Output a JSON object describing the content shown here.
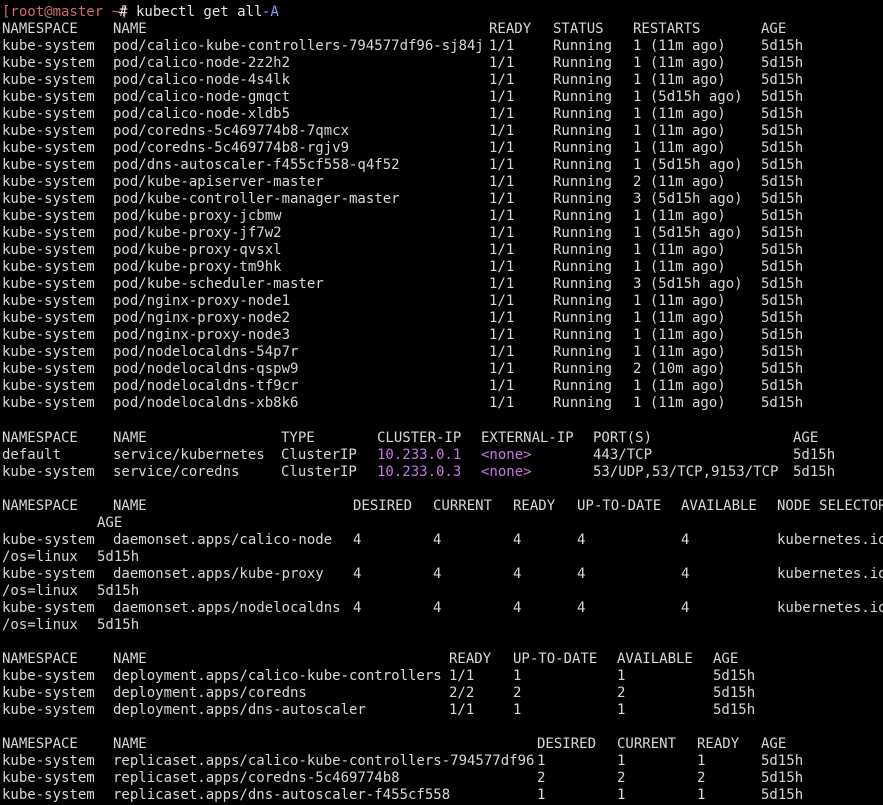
{
  "prompt": {
    "user_host": "[root@master ~]",
    "symbol": "# ",
    "command": "kubectl get all ",
    "flag": "-A"
  },
  "pods": {
    "headers": [
      "NAMESPACE",
      "NAME",
      "READY",
      "STATUS",
      "RESTARTS",
      "AGE"
    ],
    "rows": [
      [
        "kube-system",
        "pod/calico-kube-controllers-794577df96-sj84j",
        "1/1",
        "Running",
        "1 (11m ago)",
        "5d15h"
      ],
      [
        "kube-system",
        "pod/calico-node-2z2h2",
        "1/1",
        "Running",
        "1 (11m ago)",
        "5d15h"
      ],
      [
        "kube-system",
        "pod/calico-node-4s4lk",
        "1/1",
        "Running",
        "1 (11m ago)",
        "5d15h"
      ],
      [
        "kube-system",
        "pod/calico-node-gmqct",
        "1/1",
        "Running",
        "1 (5d15h ago)",
        "5d15h"
      ],
      [
        "kube-system",
        "pod/calico-node-xldb5",
        "1/1",
        "Running",
        "1 (11m ago)",
        "5d15h"
      ],
      [
        "kube-system",
        "pod/coredns-5c469774b8-7qmcx",
        "1/1",
        "Running",
        "1 (11m ago)",
        "5d15h"
      ],
      [
        "kube-system",
        "pod/coredns-5c469774b8-rgjv9",
        "1/1",
        "Running",
        "1 (11m ago)",
        "5d15h"
      ],
      [
        "kube-system",
        "pod/dns-autoscaler-f455cf558-q4f52",
        "1/1",
        "Running",
        "1 (5d15h ago)",
        "5d15h"
      ],
      [
        "kube-system",
        "pod/kube-apiserver-master",
        "1/1",
        "Running",
        "2 (11m ago)",
        "5d15h"
      ],
      [
        "kube-system",
        "pod/kube-controller-manager-master",
        "1/1",
        "Running",
        "3 (5d15h ago)",
        "5d15h"
      ],
      [
        "kube-system",
        "pod/kube-proxy-jcbmw",
        "1/1",
        "Running",
        "1 (11m ago)",
        "5d15h"
      ],
      [
        "kube-system",
        "pod/kube-proxy-jf7w2",
        "1/1",
        "Running",
        "1 (5d15h ago)",
        "5d15h"
      ],
      [
        "kube-system",
        "pod/kube-proxy-qvsxl",
        "1/1",
        "Running",
        "1 (11m ago)",
        "5d15h"
      ],
      [
        "kube-system",
        "pod/kube-proxy-tm9hk",
        "1/1",
        "Running",
        "1 (11m ago)",
        "5d15h"
      ],
      [
        "kube-system",
        "pod/kube-scheduler-master",
        "1/1",
        "Running",
        "3 (5d15h ago)",
        "5d15h"
      ],
      [
        "kube-system",
        "pod/nginx-proxy-node1",
        "1/1",
        "Running",
        "1 (11m ago)",
        "5d15h"
      ],
      [
        "kube-system",
        "pod/nginx-proxy-node2",
        "1/1",
        "Running",
        "1 (11m ago)",
        "5d15h"
      ],
      [
        "kube-system",
        "pod/nginx-proxy-node3",
        "1/1",
        "Running",
        "1 (11m ago)",
        "5d15h"
      ],
      [
        "kube-system",
        "pod/nodelocaldns-54p7r",
        "1/1",
        "Running",
        "1 (11m ago)",
        "5d15h"
      ],
      [
        "kube-system",
        "pod/nodelocaldns-qspw9",
        "1/1",
        "Running",
        "2 (10m ago)",
        "5d15h"
      ],
      [
        "kube-system",
        "pod/nodelocaldns-tf9cr",
        "1/1",
        "Running",
        "1 (11m ago)",
        "5d15h"
      ],
      [
        "kube-system",
        "pod/nodelocaldns-xb8k6",
        "1/1",
        "Running",
        "1 (11m ago)",
        "5d15h"
      ]
    ]
  },
  "services": {
    "headers": [
      "NAMESPACE",
      "NAME",
      "TYPE",
      "CLUSTER-IP",
      "EXTERNAL-IP",
      "PORT(S)",
      "AGE"
    ],
    "rows": [
      [
        "default",
        "service/kubernetes",
        "ClusterIP",
        "10.233.0.1",
        "<none>",
        "443/TCP",
        "5d15h"
      ],
      [
        "kube-system",
        "service/coredns",
        "ClusterIP",
        "10.233.0.3",
        "<none>",
        "53/UDP,53/TCP,9153/TCP",
        "5d15h"
      ]
    ]
  },
  "daemonsets": {
    "headers": [
      "NAMESPACE",
      "NAME",
      "DESIRED",
      "CURRENT",
      "READY",
      "UP-TO-DATE",
      "AVAILABLE",
      "NODE SELECTOR"
    ],
    "header_wrap": "AGE",
    "rows": [
      {
        "cells": [
          "kube-system",
          "daemonset.apps/calico-node",
          "4",
          "4",
          "4",
          "4",
          "4",
          "kubernetes.io"
        ],
        "wrap": [
          "/os=linux",
          "5d15h"
        ]
      },
      {
        "cells": [
          "kube-system",
          "daemonset.apps/kube-proxy",
          "4",
          "4",
          "4",
          "4",
          "4",
          "kubernetes.io"
        ],
        "wrap": [
          "/os=linux",
          "5d15h"
        ]
      },
      {
        "cells": [
          "kube-system",
          "daemonset.apps/nodelocaldns",
          "4",
          "4",
          "4",
          "4",
          "4",
          "kubernetes.io"
        ],
        "wrap": [
          "/os=linux",
          "5d15h"
        ]
      }
    ]
  },
  "deployments": {
    "headers": [
      "NAMESPACE",
      "NAME",
      "READY",
      "UP-TO-DATE",
      "AVAILABLE",
      "AGE"
    ],
    "rows": [
      [
        "kube-system",
        "deployment.apps/calico-kube-controllers",
        "1/1",
        "1",
        "1",
        "5d15h"
      ],
      [
        "kube-system",
        "deployment.apps/coredns",
        "2/2",
        "2",
        "2",
        "5d15h"
      ],
      [
        "kube-system",
        "deployment.apps/dns-autoscaler",
        "1/1",
        "1",
        "1",
        "5d15h"
      ]
    ]
  },
  "replicasets": {
    "headers": [
      "NAMESPACE",
      "NAME",
      "DESIRED",
      "CURRENT",
      "READY",
      "AGE"
    ],
    "rows": [
      [
        "kube-system",
        "replicaset.apps/calico-kube-controllers-794577df96",
        "1",
        "1",
        "1",
        "5d15h"
      ],
      [
        "kube-system",
        "replicaset.apps/coredns-5c469774b8",
        "2",
        "2",
        "2",
        "5d15h"
      ],
      [
        "kube-system",
        "replicaset.apps/dns-autoscaler-f455cf558",
        "1",
        "1",
        "1",
        "5d15h"
      ]
    ]
  },
  "colors": {
    "background": "#000000",
    "text": "#d7d7d7",
    "prompt": "#d26a6a",
    "highlight": "#c678dd",
    "flag": "#7aa2f7"
  }
}
